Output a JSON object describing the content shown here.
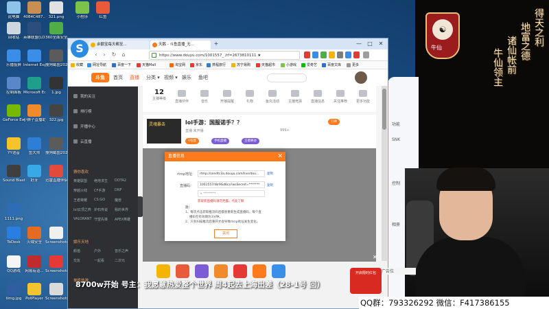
{
  "desktop": {
    "icons": [
      {
        "label": "此电脑",
        "color": "#8fc3ea"
      },
      {
        "label": "4084C487...",
        "color": "#c98f52"
      },
      {
        "label": "321.png",
        "color": "#e2e2e2"
      },
      {
        "label": "回收站",
        "color": "#cfd6de"
      },
      {
        "label": "英雄联盟(LOL)...",
        "color": "#2b4e7d"
      },
      {
        "label": "360全面安全卫士",
        "color": "#4fae46"
      },
      {
        "label": "乐播投屏",
        "color": "#3a8ee8"
      },
      {
        "label": "Internet Explorer",
        "color": "#3a8ee8"
      },
      {
        "label": "搜狗截图20210...",
        "color": "#5b5b5b"
      },
      {
        "label": "控制面板",
        "color": "#5a87c9"
      },
      {
        "label": "Microsoft Edge",
        "color": "#1f9e8c"
      },
      {
        "label": "1.jpg",
        "color": "#333333"
      },
      {
        "label": "GeForce Experience",
        "color": "#76b900"
      },
      {
        "label": "小狮子直播助手",
        "color": "#f08a2a"
      },
      {
        "label": "322.jpg",
        "color": "#444444"
      },
      {
        "label": "YY语音",
        "color": "#f7c32a"
      },
      {
        "label": "鱼大师",
        "color": "#2f7ed6"
      },
      {
        "label": "搜狗截图20210...",
        "color": "#5b5b5b"
      },
      {
        "label": "Sound Blaster...",
        "color": "#3f3f3f"
      },
      {
        "label": "好牙",
        "color": "#38a9e6"
      },
      {
        "label": "迅雷直播伴侣",
        "color": "#e24b3c"
      },
      {
        "label": "1111.png",
        "color": "#2d6db5"
      },
      {
        "label": "ToDesk",
        "color": "#2a7de1"
      },
      {
        "label": "火绒安全",
        "color": "#e66a20"
      },
      {
        "label": "Screenshots",
        "color": "#f0f0f0"
      },
      {
        "label": "QQ游戏",
        "color": "#f5f5f5"
      },
      {
        "label": "网易有道...",
        "color": "#c22b2b"
      },
      {
        "label": "Screenshots",
        "color": "#e53935"
      },
      {
        "label": "timg.jpg",
        "color": "#2f5fa0"
      },
      {
        "label": "PotPlayer",
        "color": "#f4c430"
      },
      {
        "label": "Screenshots",
        "color": "#dadada"
      },
      {
        "label": "小程序",
        "color": "#7dc34b"
      },
      {
        "label": "红鱼",
        "color": "#e85a3a"
      }
    ]
  },
  "browser": {
    "tabs": [
      {
        "label": "余额宝每天都至..."
      },
      {
        "label": "天鹅 - 斗鱼直播_无...",
        "active": true
      }
    ],
    "new_tab": "+",
    "url": "https://www.douyu.com/1001557_ /rf=2673810111 ★",
    "window_controls": [
      "—",
      "□",
      "✕"
    ],
    "bookmarks": [
      {
        "label": "收藏",
        "color": "#f4b400"
      },
      {
        "label": "网址导航",
        "color": "#3a8ee8"
      },
      {
        "label": "百度一下",
        "color": "#2f6fd1"
      },
      {
        "label": "天猫Mall",
        "color": "#e53935"
      },
      {
        "label": "淘宝网",
        "color": "#ff6a00"
      },
      {
        "label": "京东",
        "color": "#e53935"
      },
      {
        "label": "携程旅行",
        "color": "#2f7ed6"
      },
      {
        "label": "苏宁易购",
        "color": "#f4b400"
      },
      {
        "label": "天猫超市",
        "color": "#e53935"
      },
      {
        "label": "小游戏",
        "color": "#7dc34b"
      },
      {
        "label": "爱奇艺",
        "color": "#00be06"
      },
      {
        "label": "百度文库",
        "color": "#2f6fd1"
      },
      {
        "label": "更多",
        "color": "#999999"
      }
    ]
  },
  "douyu": {
    "logo": "斗鱼",
    "nav": [
      "首页",
      "直播",
      "分类 ▾",
      "视频 ▾",
      "娱乐",
      "鱼吧"
    ],
    "active_nav": 1,
    "sidebar": {
      "items": [
        "我的关注",
        "排行榜",
        "开播中心",
        "云直播"
      ],
      "grid_title": "猜你喜欢",
      "grid_rows": [
        [
          "英雄联盟",
          "绝地求生",
          "DOTA2"
        ],
        [
          "穿越火线",
          "CF手游",
          "DNF"
        ],
        [
          "王者荣耀",
          "CS:GO",
          "魔兽"
        ],
        [
          "lol云顶之弈",
          "炉石传说",
          "我的世界"
        ],
        [
          "VALORANT",
          "守望先锋",
          "APEX英雄"
        ]
      ],
      "section2": "娱乐天地",
      "grid2_rows": [
        [
          "颜值",
          "户外",
          "音乐之声"
        ],
        [
          "交友",
          "一起看",
          "二次元"
        ]
      ],
      "section3": "单机热游"
    },
    "stats": [
      {
        "num": "12",
        "label": "主播等级"
      },
      {
        "label": "直播伙伴"
      },
      {
        "label": "音乐"
      },
      {
        "label": "开播提醒"
      },
      {
        "label": "礼物"
      },
      {
        "label": "鱼丸活动"
      },
      {
        "label": "主播竞猜"
      },
      {
        "label": "直播信息"
      },
      {
        "label": "关注推荐"
      },
      {
        "label": "更多功能"
      }
    ],
    "room": {
      "thumb_text": "灵魂暴击",
      "title": "lol手游：国服诺手？？",
      "meta": "直播  未开播",
      "chips": [
        "V标签",
        "手机直播",
        "王者峡谷"
      ],
      "fans": "999+",
      "follow": "订阅"
    }
  },
  "modal": {
    "title": "直播信息",
    "close": "✕",
    "rtmp_label": "rtmp地址:",
    "rtmp_value": "rtmp://sendtc3a.douyu.com/live/dou...",
    "rtmp_copy": "复制",
    "key_label": "直播码:",
    "key_value": "1001557rl8r9Gd6ca?wsSecret=*******",
    "key_copy": "复制",
    "key_hint": "×  ********",
    "warn": "获取新直播码请勿泄露，点此了解",
    "note_title": "注：",
    "notes": [
      "1、每次点击获取推流码后都会重新生成直播码，每个直",
      "播码在有效期为3分钟。",
      "2、只有扫描推流后重开才会导致rtmp地址发生变化。"
    ],
    "confirm": "关闭"
  },
  "stream": {
    "ticker": "8700w开始 号主：我愿意热爱整个世界 周4起去上海出差（28-1号 回）",
    "contact": "QQ群：793326292  微信：F417386155",
    "seal_text": "牛仙",
    "calligraphy": [
      "得天之利",
      "地富之德",
      "诸仙帐前",
      "牛仙领主"
    ],
    "phone_labels": [
      "功能",
      "SNK",
      "控制",
      "相册"
    ],
    "redbox_label": "开启限时红包",
    "ad_label": "广告位"
  },
  "colors": {
    "accent": "#ff7a1a",
    "browser_chrome": "#d6e4f5",
    "sidebar": "#2d2f33"
  }
}
